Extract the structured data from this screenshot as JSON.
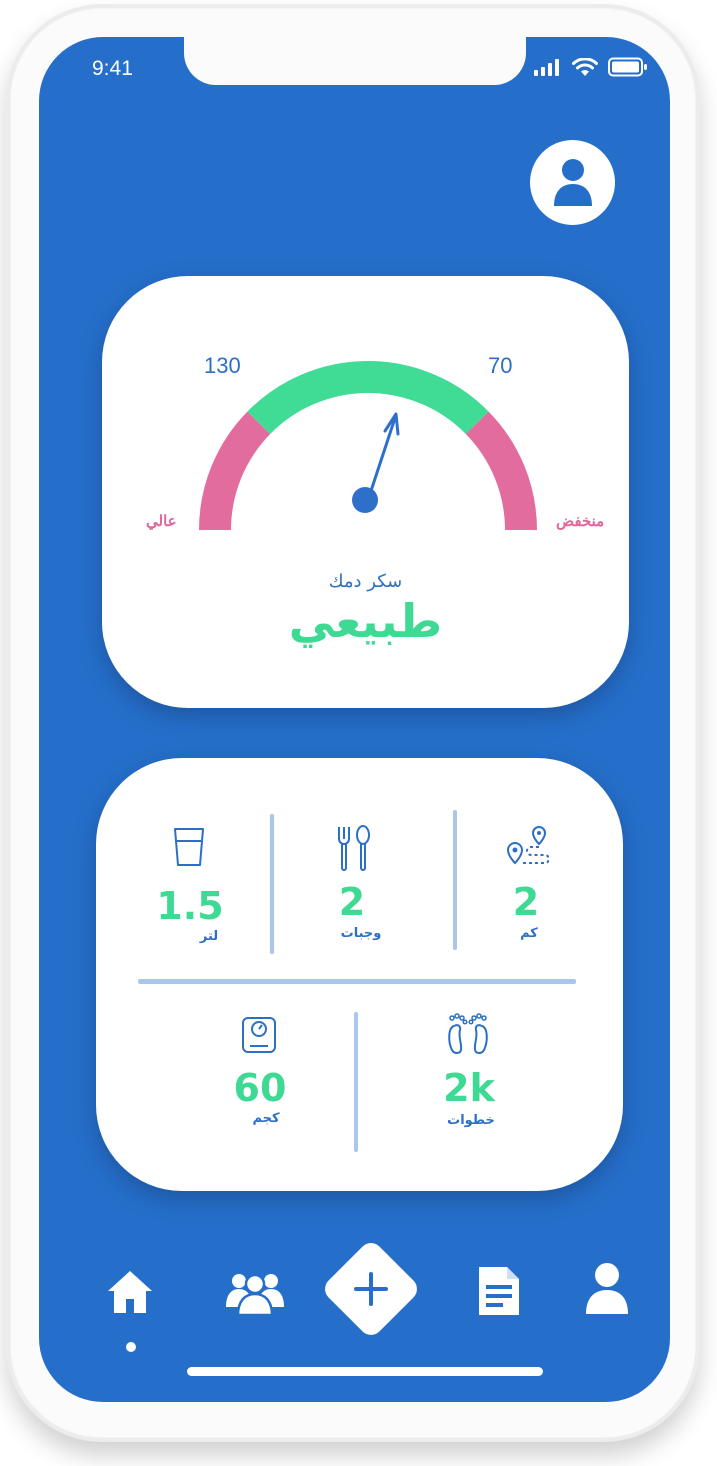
{
  "status_bar": {
    "time": "9:41"
  },
  "gauge": {
    "tick_high": "130",
    "tick_low": "70",
    "label_high": "عالي",
    "label_low": "منخفض",
    "title": "سكر دمك",
    "status": "طبيعي",
    "colors": {
      "normal": "#40db94",
      "abnormal": "#e36c9e",
      "needle": "#2e6fca"
    }
  },
  "stats": [
    {
      "icon": "glass-icon",
      "value": "1.5",
      "unit": "لتر"
    },
    {
      "icon": "fork-spoon-icon",
      "value": "2",
      "unit": "وجبات"
    },
    {
      "icon": "route-pin-icon",
      "value": "2",
      "unit": "كم"
    },
    {
      "icon": "scale-icon",
      "value": "60",
      "unit": "كجم"
    },
    {
      "icon": "footprints-icon",
      "value": "2k",
      "unit": "خطوات"
    }
  ],
  "nav": [
    {
      "icon": "home-icon",
      "active": true
    },
    {
      "icon": "group-icon"
    },
    {
      "icon": "plus-icon"
    },
    {
      "icon": "document-icon"
    },
    {
      "icon": "user-icon"
    }
  ],
  "theme": {
    "primary": "#256fca",
    "accent": "#3ed992",
    "divider": "#a9c6ec"
  }
}
